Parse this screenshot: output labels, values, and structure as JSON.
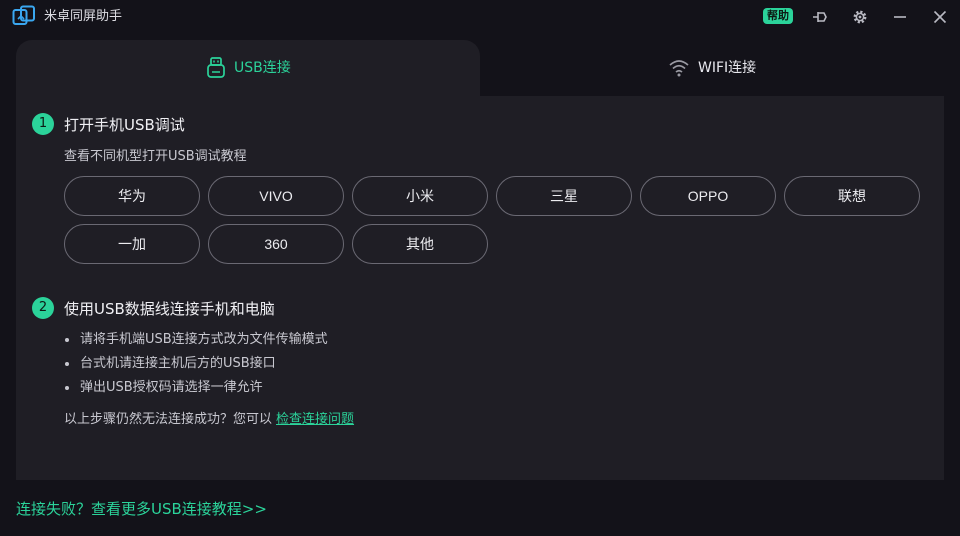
{
  "titlebar": {
    "title": "米卓同屏助手",
    "help_badge": "帮助",
    "icons": [
      "app-logo-icon",
      "pin-icon",
      "gear-icon",
      "minimize-icon",
      "close-icon"
    ]
  },
  "tabs": [
    {
      "label": "USB连接",
      "icon": "usb-icon",
      "active": true
    },
    {
      "label": "WIFI连接",
      "icon": "wifi-icon",
      "active": false
    }
  ],
  "step1": {
    "num": "1",
    "title": "打开手机USB调试",
    "subtitle": "查看不同机型打开USB调试教程",
    "brands": [
      "华为",
      "VIVO",
      "小米",
      "三星",
      "OPPO",
      "联想",
      "一加",
      "360",
      "其他"
    ]
  },
  "step2": {
    "num": "2",
    "title": "使用USB数据线连接手机和电脑",
    "bullets": [
      "请将手机端USB连接方式改为文件传输模式",
      "台式机请连接主机后方的USB接口",
      "弹出USB授权码请选择一律允许"
    ],
    "help_prefix": "以上步骤仍然无法连接成功？您可以",
    "help_link": "检查连接问题"
  },
  "footer": {
    "link": "连接失败？查看更多USB连接教程>>"
  },
  "colors": {
    "accent": "#2bd39a",
    "background": "#131219",
    "panel": "#1f1e25",
    "button_border": "#6a6973"
  }
}
